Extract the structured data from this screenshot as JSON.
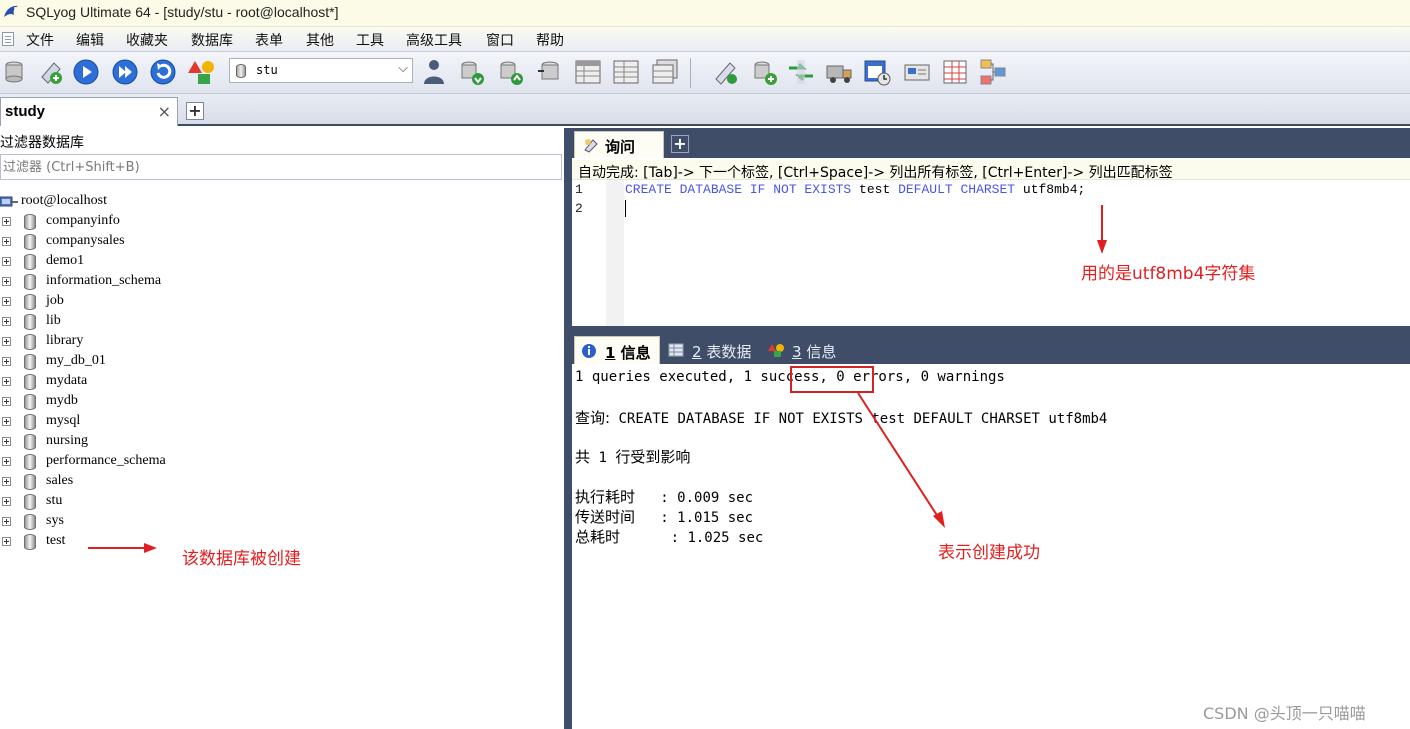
{
  "window": {
    "title": "SQLyog Ultimate 64 - [study/stu - root@localhost*]"
  },
  "menu": [
    "文件",
    "编辑",
    "收藏夹",
    "数据库",
    "表单",
    "其他",
    "工具",
    "高级工具",
    "窗口",
    "帮助"
  ],
  "toolbar": {
    "database_select_value": "stu"
  },
  "connection_tab": {
    "label": "study",
    "close": "×",
    "add": "+"
  },
  "object_browser": {
    "filter_title": "过滤器数据库",
    "filter_placeholder": "过滤器 (Ctrl+Shift+B)",
    "root": "root@localhost",
    "databases": [
      "companyinfo",
      "companysales",
      "demo1",
      "information_schema",
      "job",
      "lib",
      "library",
      "my_db_01",
      "mydata",
      "mydb",
      "mysql",
      "nursing",
      "performance_schema",
      "sales",
      "stu",
      "sys",
      "test"
    ]
  },
  "query_tab": {
    "label": "询问",
    "add": "+"
  },
  "editor": {
    "hint": "自动完成: [Tab]-> 下一个标签, [Ctrl+Space]-> 列出所有标签, [Ctrl+Enter]-> 列出匹配标签",
    "line_numbers": [
      "1",
      "2"
    ],
    "line1": {
      "kw1": "CREATE DATABASE IF NOT EXISTS",
      "name": " test ",
      "kw2": "DEFAULT CHARSET",
      "tail": " utf8mb4;"
    }
  },
  "result_tabs": [
    {
      "num": "1",
      "label": " 信息"
    },
    {
      "num": "2",
      "label": " 表数据"
    },
    {
      "num": "3",
      "label": " 信息"
    }
  ],
  "result": {
    "summary": "1 queries executed, 1 success, 0 errors, 0 warnings",
    "query_label": "查询:",
    "query_sql": " CREATE DATABASE IF NOT EXISTS test DEFAULT CHARSET utf8mb4",
    "affected_prefix": "共",
    "affected_count": " 1 ",
    "affected_suffix": "行受到影响",
    "exec_label": "执行耗时",
    "exec_value": "   : 0.009 sec",
    "transfer_label": "传送时间",
    "transfer_value": "   : 1.015 sec",
    "total_label": "总耗时",
    "total_value": "      : 1.025 sec"
  },
  "annotations": {
    "charset_note": "用的是utf8mb4字符集",
    "success_note": "表示创建成功",
    "created_note": "该数据库被创建"
  },
  "watermark": "CSDN @头顶一只喵喵",
  "colors": {
    "keyword": "#4a55e8",
    "annotation": "#e02020",
    "panel_dark": "#3f4d68"
  }
}
